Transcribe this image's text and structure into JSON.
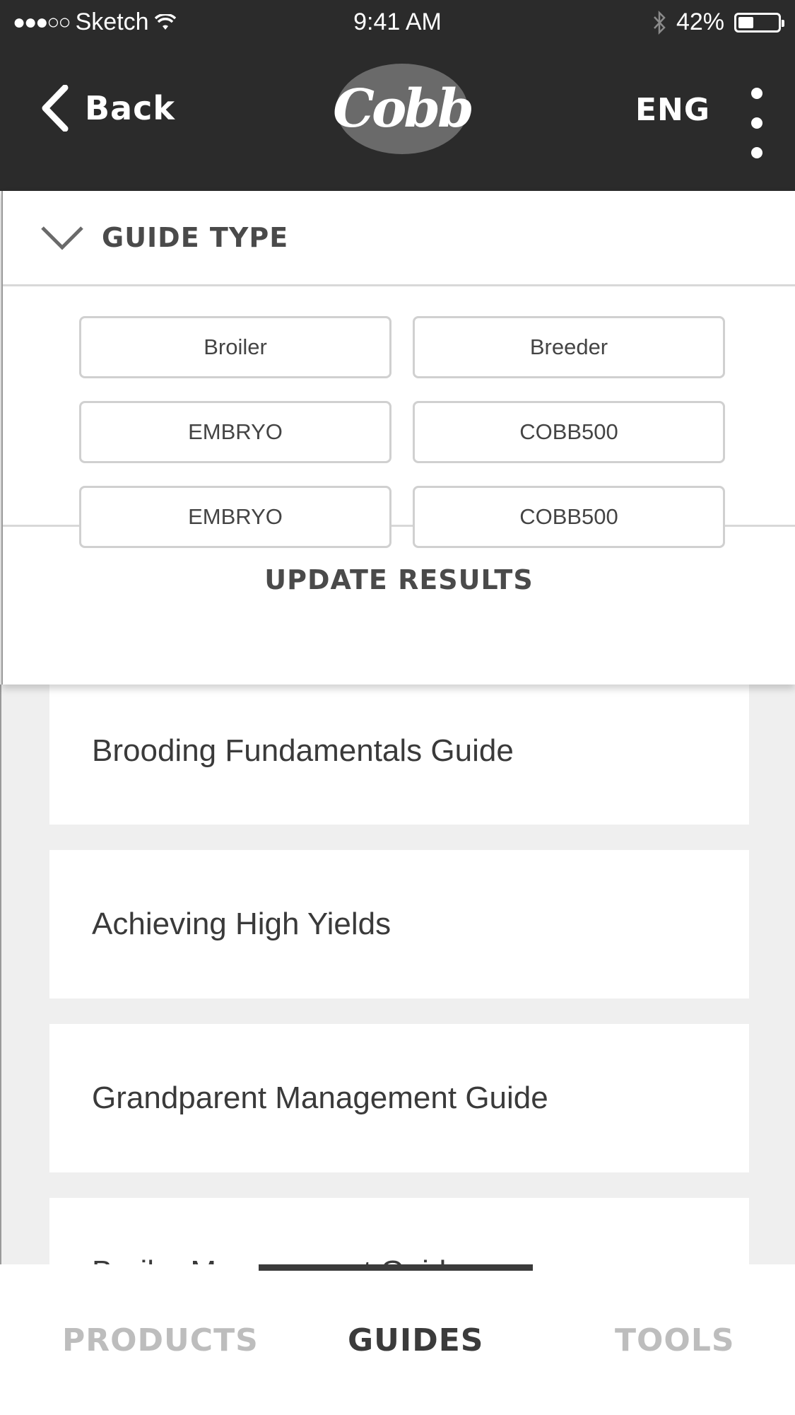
{
  "status_bar": {
    "carrier": "Sketch",
    "time": "9:41 AM",
    "battery": "42%",
    "battery_level": 0.42
  },
  "header": {
    "back_label": "Back",
    "logo_text": "Cobb",
    "language": "ENG"
  },
  "filter": {
    "title": "GUIDE TYPE",
    "chips": [
      "Broiler",
      "Breeder",
      "EMBRYO",
      "COBB500",
      "EMBRYO",
      "COBB500"
    ],
    "update_label": "UPDATE RESULTS"
  },
  "guides": {
    "items": [
      "Brooding Fundamentals Guide",
      "Achieving High Yields",
      "Grandparent Management Guide",
      "Broiler Management Guide"
    ]
  },
  "tabs": {
    "products": "PRODUCTS",
    "guides": "GUIDES",
    "tools": "TOOLS",
    "active": "GUIDES"
  },
  "colors": {
    "header_bg": "#2b2b2b",
    "page_bg": "#efefef",
    "inactive_tab": "#bdbdbd",
    "active_tab": "#3b3b3b"
  }
}
